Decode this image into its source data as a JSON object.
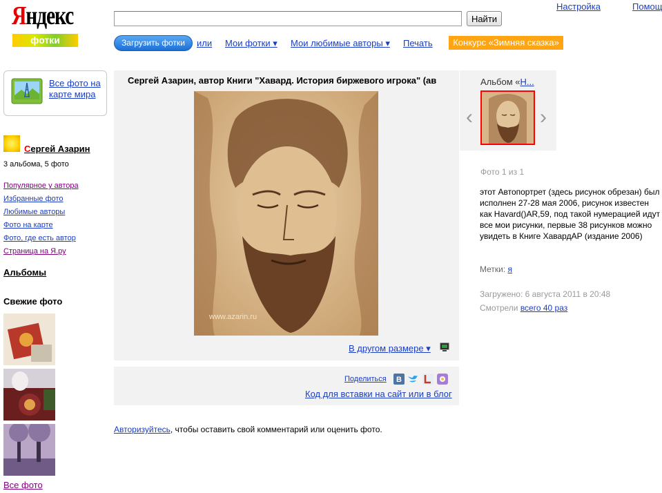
{
  "header": {
    "logo_word_first": "Я",
    "logo_word_rest": "ндекс",
    "logo_sub": "фотки",
    "search_value": "",
    "search_button": "Найти",
    "settings_link": "Настройка",
    "help_link": "Помощь"
  },
  "nav": {
    "upload_button": "Загрузить фотки",
    "or": "или",
    "my_photos": "Мои фотки ▾",
    "favorite_authors": "Мои любимые авторы ▾",
    "print": "Печать",
    "contest": "Конкурс «Зимняя сказка»"
  },
  "sidebar": {
    "map_link": "Все фото на карте мира",
    "author_first_letter": "С",
    "author_name_rest": "ергей Азарин",
    "author_stats": "3 альбома, 5 фото",
    "links": [
      "Популярное у автора",
      "Избранные фото",
      "Любимые авторы",
      "Фото на карте",
      "Фото, где есть автор",
      "Страница на Я.ру"
    ],
    "albums_heading": "Альбомы",
    "fresh_heading": "Свежие фото",
    "all_photos": "Все фото"
  },
  "photo": {
    "title": "Сергей Азарин, автор Книги \"Хавард. История биржевого игрока\" (ав",
    "watermark": "www.azarin.ru",
    "other_size_link": "В другом размере ▾",
    "share_label": "Поделиться",
    "embed_link": "Код для вставки на сайт или в блог",
    "auth_link": "Авторизуйтесь",
    "auth_rest": ", чтобы оставить свой комментарий или оценить фото."
  },
  "album": {
    "label": "Альбом «",
    "name": "Н..."
  },
  "details": {
    "photo_count": "Фото 1 из 1",
    "description": "этот Автопортрет (здесь рисунок обрезан) был исполнен 27-28 мая 2006, рисунок известен как Havard()AR,59, под такой нумерацией идут все мои рисунки, первые 38 рисунков можно увидеть в Книге ХавардАР (издание 2006)",
    "tags_label": "Метки: ",
    "tag": "я",
    "uploaded": "Загружено: 6 августа 2011 в 20:48",
    "views_label": "Смотрели ",
    "views_link": "всего 40 раз"
  },
  "colors": {
    "link": "#1a3dc1",
    "visited": "#800080",
    "contest": "#ffa412",
    "upload_button": "#2f86e6",
    "panel": "#f2f2f2"
  }
}
